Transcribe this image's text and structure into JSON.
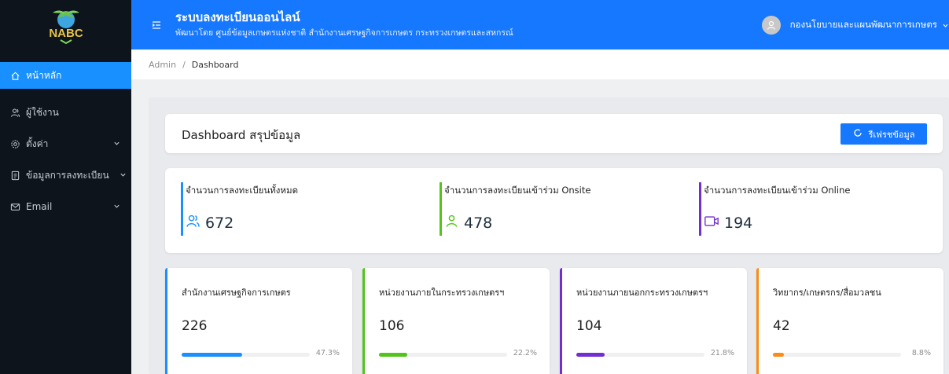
{
  "sidebar": {
    "logo_text": "NABC",
    "items": [
      {
        "label": "หน้าหลัก",
        "icon": "home-icon",
        "active": true,
        "chevron": false
      },
      {
        "label": "ผู้ใช้งาน",
        "icon": "users-icon",
        "active": false,
        "chevron": false
      },
      {
        "label": "ตั้งค่า",
        "icon": "gear-icon",
        "active": false,
        "chevron": true
      },
      {
        "label": "ข้อมูลการลงทะเบียน",
        "icon": "document-icon",
        "active": false,
        "chevron": true
      },
      {
        "label": "Email",
        "icon": "mail-icon",
        "active": false,
        "chevron": true
      }
    ]
  },
  "header": {
    "title": "ระบบลงทะเบียนออนไลน์",
    "subtitle": "พัฒนาโดย ศูนย์ข้อมูลเกษตรแห่งชาติ สำนักงานเศรษฐกิจการเกษตร กระทรวงเกษตรและสหกรณ์",
    "user_name": "กองนโยบายและแผนพัฒนาการเกษตร"
  },
  "breadcrumb": {
    "root": "Admin",
    "separator": "/",
    "current": "Dashboard"
  },
  "dashboard": {
    "title": "Dashboard สรุปข้อมูล",
    "refresh_label": "รีเฟรชข้อมูล"
  },
  "stats": [
    {
      "label": "จำนวนการลงทะเบียนทั้งหมด",
      "value": "672",
      "color": "#1890ff",
      "icon": "users-icon"
    },
    {
      "label": "จำนวนการลงทะเบียนเข้าร่วม Onsite",
      "value": "478",
      "color": "#52c41a",
      "icon": "user-icon"
    },
    {
      "label": "จำนวนการลงทะเบียนเข้าร่วม Online",
      "value": "194",
      "color": "#722ed1",
      "icon": "video-icon"
    }
  ],
  "groups": [
    {
      "label": "สำนักงานเศรษฐกิจการเกษตร",
      "value": "226",
      "percent": 47.3,
      "percent_text": "47.3%",
      "color": "#1890ff"
    },
    {
      "label": "หน่วยงานภายในกระทรวงเกษตรฯ",
      "value": "106",
      "percent": 22.2,
      "percent_text": "22.2%",
      "color": "#52c41a"
    },
    {
      "label": "หน่วยงานภายนอกกระทรวงเกษตรฯ",
      "value": "104",
      "percent": 21.8,
      "percent_text": "21.8%",
      "color": "#722ed1"
    },
    {
      "label": "วิทยากร/เกษตรกร/สื่อมวลชน",
      "value": "42",
      "percent": 8.8,
      "percent_text": "8.8%",
      "color": "#fa8c16"
    }
  ]
}
